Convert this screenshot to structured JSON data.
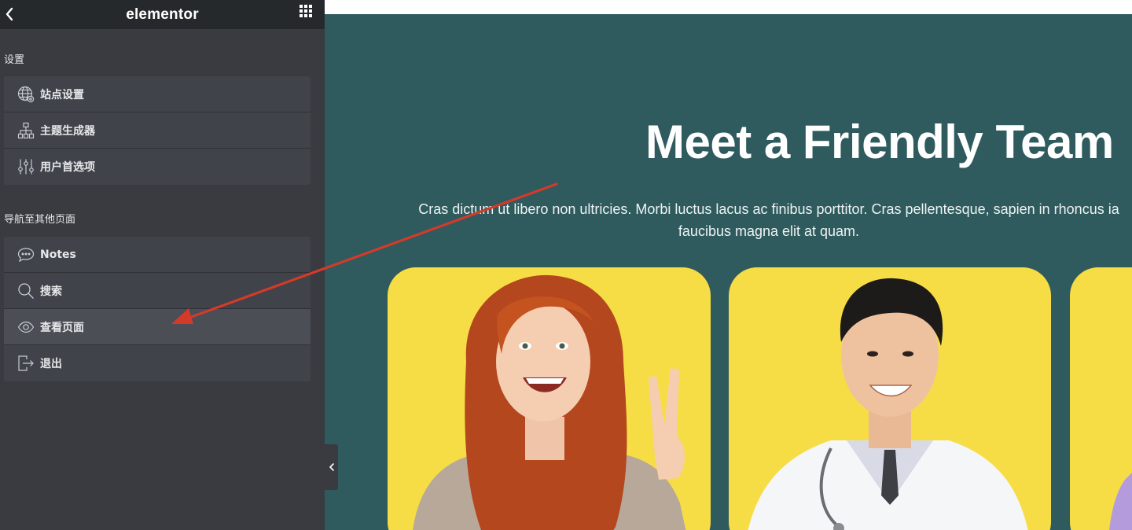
{
  "panel": {
    "logo": "elementor",
    "settings_title": "设置",
    "settings_items": [
      {
        "label": "站点设置",
        "icon": "globe-settings-icon"
      },
      {
        "label": "主题生成器",
        "icon": "sitemap-icon"
      },
      {
        "label": "用户首选项",
        "icon": "sliders-icon"
      }
    ],
    "navigate_title": "导航至其他页面",
    "navigate_items": [
      {
        "label": "Notes",
        "icon": "chat-bubble-icon"
      },
      {
        "label": "搜索",
        "icon": "search-icon"
      },
      {
        "label": "查看页面",
        "icon": "eye-icon"
      },
      {
        "label": "退出",
        "icon": "exit-icon"
      }
    ]
  },
  "page": {
    "heading": "Meet a Friendly Team",
    "text_line1": "Cras dictum ut libero non ultricies. Morbi luctus lacus ac finibus porttitor. Cras pellentesque, sapien in rhoncus ia",
    "text_line2": "faucibus magna elit at quam.",
    "card_color": "#f7dd45",
    "hero_color": "#2f5b5e"
  },
  "colors": {
    "panel_bg": "#393b40",
    "panel_header": "#26292c",
    "menu_item_bg": "#404349",
    "arrow": "#d43a2a"
  }
}
